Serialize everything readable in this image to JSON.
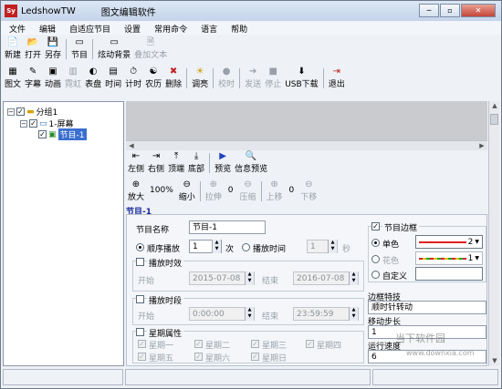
{
  "app": {
    "icon_text": "Sy",
    "title": "LedshowTW",
    "subtitle": "图文编辑软件"
  },
  "window_buttons": [
    "─",
    "▫",
    "✕"
  ],
  "menu": [
    "文件",
    "编辑",
    "自适应节目",
    "设置",
    "常用命令",
    "语言",
    "帮助"
  ],
  "toolbar1": [
    {
      "label": "新建",
      "icon": "📄",
      "disabled": false
    },
    {
      "label": "打开",
      "icon": "📂",
      "disabled": false
    },
    {
      "label": "另存",
      "icon": "💾",
      "disabled": false
    },
    {
      "label": "节目",
      "icon": "▭",
      "disabled": false
    },
    {
      "label": "炫动背景",
      "icon": "▭",
      "disabled": false
    },
    {
      "label": "叠加文本",
      "icon": "🗎",
      "disabled": true
    }
  ],
  "toolbar2": [
    {
      "label": "图文",
      "icon": "▦",
      "disabled": false
    },
    {
      "label": "字幕",
      "icon": "✎",
      "disabled": false
    },
    {
      "label": "动画",
      "icon": "▣",
      "disabled": false
    },
    {
      "label": "霓虹",
      "icon": "▥",
      "disabled": true
    },
    {
      "label": "表盘",
      "icon": "◐",
      "disabled": false
    },
    {
      "label": "时间",
      "icon": "▤",
      "disabled": false
    },
    {
      "label": "计时",
      "icon": "⏱",
      "disabled": false
    },
    {
      "label": "农历",
      "icon": "☯",
      "disabled": false
    },
    {
      "label": "删除",
      "icon": "✖",
      "disabled": false
    },
    {
      "label": "调亮",
      "icon": "☀",
      "disabled": false
    },
    {
      "label": "校时",
      "icon": "●",
      "disabled": true
    },
    {
      "label": "发送",
      "icon": "➔",
      "disabled": true
    },
    {
      "label": "停止",
      "icon": "■",
      "disabled": true
    },
    {
      "label": "USB下载",
      "icon": "⬇",
      "disabled": false
    },
    {
      "label": "退出",
      "icon": "⇥",
      "disabled": false
    }
  ],
  "tree": {
    "group": "分组1",
    "screen": "1-屏幕",
    "program": "节目-1"
  },
  "toolbar_align": [
    {
      "label": "左侧",
      "icon": "⇤"
    },
    {
      "label": "右侧",
      "icon": "⇥"
    },
    {
      "label": "顶端",
      "icon": "⤒"
    },
    {
      "label": "底部",
      "icon": "⤓"
    },
    {
      "label": "预览",
      "icon": "▶"
    },
    {
      "label": "信息预览",
      "icon": "🔍"
    }
  ],
  "zoom": {
    "zoom_in": "放大",
    "level": "100%",
    "zoom_out": "缩小",
    "stretch": "拉伸",
    "stretch_val": "0",
    "compress": "压缩",
    "up": "上移",
    "up_val": "0",
    "down": "下移"
  },
  "section_title": "节目-1",
  "props": {
    "name_label": "节目名称",
    "name_value": "节目-1",
    "seq_label": "顺序播放",
    "seq_value": "1",
    "seq_unit": "次",
    "time_label": "定长播放时间",
    "time_label_short": "播放时间",
    "time_value": "1",
    "time_unit": "秒",
    "validity_label": "播放时效",
    "start_label": "开始",
    "start_date": "2015-07-08",
    "end_label": "结束",
    "end_date": "2016-07-08",
    "period_label": "播放时段",
    "start_time": "0:00:00",
    "end_time": "23:59:59",
    "week_label": "星期属性",
    "weekdays": [
      "星期一",
      "星期二",
      "星期三",
      "星期四",
      "星期五",
      "星期六",
      "星期日"
    ]
  },
  "border": {
    "label": "节目边框",
    "single": "单色",
    "single_value": "2",
    "flower": "花色",
    "flower_value": "1",
    "custom": "自定义",
    "effect_label": "边框特技",
    "effect_value": "顺时针转动",
    "step_label": "移动步长",
    "step_value": "1",
    "speed_label": "运行速度",
    "speed_value": "6"
  },
  "watermark": {
    "brand": "当下软件园",
    "url": "www.downxia.com"
  },
  "colors": {
    "accent": "#1a2a9a",
    "red_line": "#e02020",
    "yellow_line": "#d8c000"
  }
}
